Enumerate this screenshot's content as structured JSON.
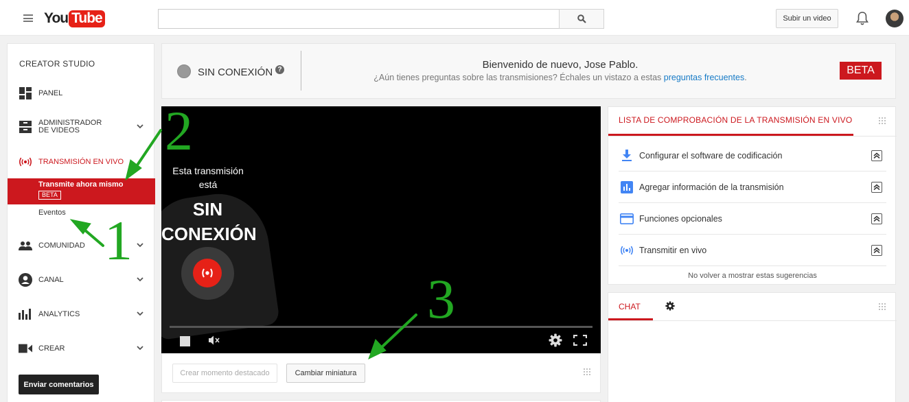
{
  "header": {
    "logo_you": "You",
    "logo_tube": "Tube",
    "search_placeholder": "",
    "upload_label": "Subir un video"
  },
  "sidebar": {
    "title": "CREATOR STUDIO",
    "items": [
      {
        "label": "PANEL",
        "icon": "dashboard-icon",
        "has_chevron": false
      },
      {
        "label": "ADMINISTRADOR DE VIDEOS",
        "icon": "video-manager-icon",
        "has_chevron": true
      },
      {
        "label": "TRANSMISIÓN EN VIVO",
        "icon": "live-broadcast-icon",
        "has_chevron": false,
        "active": true
      },
      {
        "label": "COMUNIDAD",
        "icon": "community-icon",
        "has_chevron": true
      },
      {
        "label": "CANAL",
        "icon": "channel-icon",
        "has_chevron": true
      },
      {
        "label": "ANALYTICS",
        "icon": "analytics-icon",
        "has_chevron": true
      },
      {
        "label": "CREAR",
        "icon": "create-icon",
        "has_chevron": true
      }
    ],
    "live_sub": {
      "active_label": "Transmite ahora mismo",
      "active_badge": "BETA",
      "events_label": "Eventos"
    },
    "feedback_label": "Enviar comentarios"
  },
  "status": {
    "state_label": "SIN CONEXIÓN",
    "help_glyph": "?",
    "welcome": "Bienvenido de nuevo, Jose Pablo.",
    "question_prefix": "¿Aún tienes preguntas sobre las transmisiones? Échales un vistazo a estas ",
    "faq_link": "preguntas frecuentes",
    "question_suffix": ".",
    "beta_badge": "BETA"
  },
  "player": {
    "line1": "Esta transmisión está",
    "line2": "SIN CONEXIÓN",
    "progress_fraction": 0
  },
  "controls": {
    "highlight_label": "Crear momento destacado",
    "thumbnail_label": "Cambiar miniatura"
  },
  "checklist": {
    "title": "LISTA DE COMPROBACIÓN DE LA TRANSMISIÓN EN VIVO",
    "items": [
      {
        "label": "Configurar el software de codificación",
        "icon": "download-icon"
      },
      {
        "label": "Agregar información de la transmisión",
        "icon": "info-chart-icon"
      },
      {
        "label": "Funciones opcionales",
        "icon": "card-icon"
      },
      {
        "label": "Transmitir en vivo",
        "icon": "live-broadcast-icon"
      }
    ],
    "footer": "No volver a mostrar estas sugerencias"
  },
  "chat": {
    "tab_label": "CHAT"
  },
  "annotations": [
    "2",
    "1",
    "3"
  ],
  "colors": {
    "brand_red": "#cc181e",
    "link_blue": "#167ac6",
    "annotation_green": "#22a722",
    "icon_blue": "#4285f4"
  }
}
